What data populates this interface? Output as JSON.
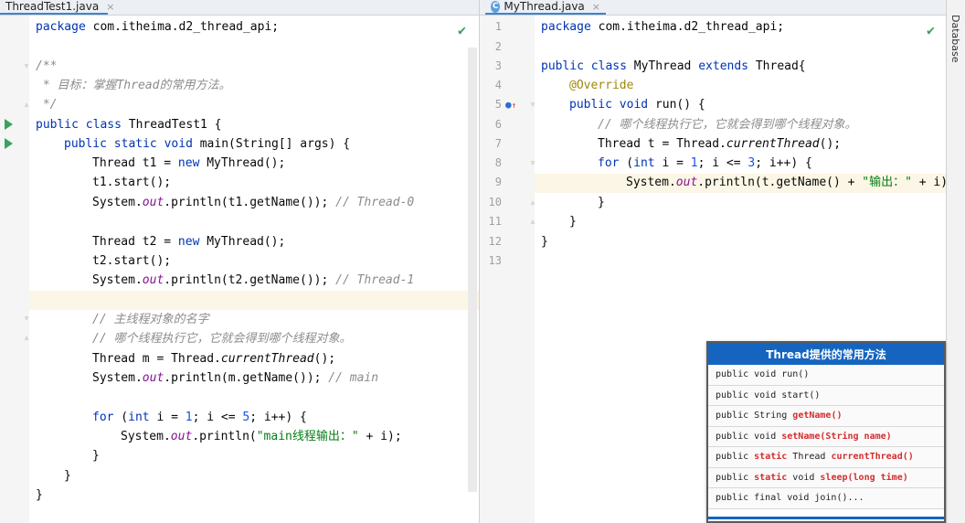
{
  "left_tab": {
    "label": "ThreadTest1.java",
    "close": "×"
  },
  "right_tab": {
    "label": "MyThread.java",
    "close": "×",
    "icon": "C"
  },
  "sidebar": {
    "database_label": "Database"
  },
  "left_code": {
    "l1_pkg": "com.itheima.d2_thread_api;",
    "l2_doc_open": "/**",
    "l3_doc_text": " * 目标：掌握Thread的常用方法。",
    "l4_doc_close": " */",
    "l5_class_name": "ThreadTest1 {",
    "l6_main": "main(String[] args) {",
    "l7_t1": "Thread t1 = ",
    "l7_rest": "MyThread();",
    "l8": "t1.start();",
    "l9_a": "System.",
    "l9_b": ".println(t1.getName()); ",
    "l9_c": "// Thread-0",
    "l10_t2": "Thread t2 = ",
    "l10_rest": "MyThread();",
    "l11": "t2.start();",
    "l12_b": ".println(t2.getName()); ",
    "l12_c": "// Thread-1",
    "l13_cmt": "// 主线程对象的名字",
    "l14_cmt": "// 哪个线程执行它，它就会得到哪个线程对象。",
    "l15_a": "Thread m = Thread.",
    "l15_b": "currentThread",
    "l15_c": "();",
    "l16_b": ".println(m.getName()); ",
    "l16_c": "// main",
    "l17_a": " (",
    "l17_b": " i = ",
    "l17_c": "; i <= ",
    "l17_d": "; i++) {",
    "l18_b": ".println(",
    "l18_str": "\"main线程输出：\"",
    "l18_c": " + i);",
    "brace_close": "}",
    "kw_package": "package",
    "kw_public": "public",
    "kw_class": "class",
    "kw_static": "static",
    "kw_void": "void",
    "kw_new": "new",
    "kw_for": "for",
    "kw_int": "int",
    "fld_out": "out",
    "num_1": "1",
    "num_5": "5"
  },
  "right_code": {
    "line_numbers": [
      "1",
      "2",
      "3",
      "4",
      "5",
      "6",
      "7",
      "8",
      "9",
      "10",
      "11",
      "12",
      "13"
    ],
    "l1_pkg": "com.itheima.d2_thread_api;",
    "l3_a": "MyThread ",
    "l3_b": "extends",
    "l3_c": " Thread{",
    "l4_ann": "@Override",
    "l5_a": "run() {",
    "l6_cmt": "// 哪个线程执行它，它就会得到哪个线程对象。",
    "l7_a": "Thread t = Thread.",
    "l7_b": "currentThread",
    "l7_c": "();",
    "l8_d": "; i++) {",
    "l8_c": "; i <= ",
    "num_3": "3",
    "l9_b": ".println(t.getName() + ",
    "l9_str": "\"输出：\"",
    "l9_c": " + i)"
  },
  "overlay": {
    "title": "Thread提供的常用方法",
    "rows": {
      "r1": "public void run()",
      "r2": "public void start()",
      "r3_a": "public String ",
      "r3_b": "getName()",
      "r4_a": "public void ",
      "r4_b": "setName(String name)",
      "r5_a": "public ",
      "r5_b": "static",
      "r5_c": " Thread ",
      "r5_d": "currentThread()",
      "r6_a": "public ",
      "r6_b": "static",
      "r6_c": " void ",
      "r6_d": "sleep(long time)",
      "r7": "public final void join()..."
    }
  },
  "colors": {
    "keyword": "#0033b3",
    "string": "#067d17",
    "comment": "#8c8c8c",
    "annotation": "#9e880d",
    "accent": "#1565c0"
  }
}
